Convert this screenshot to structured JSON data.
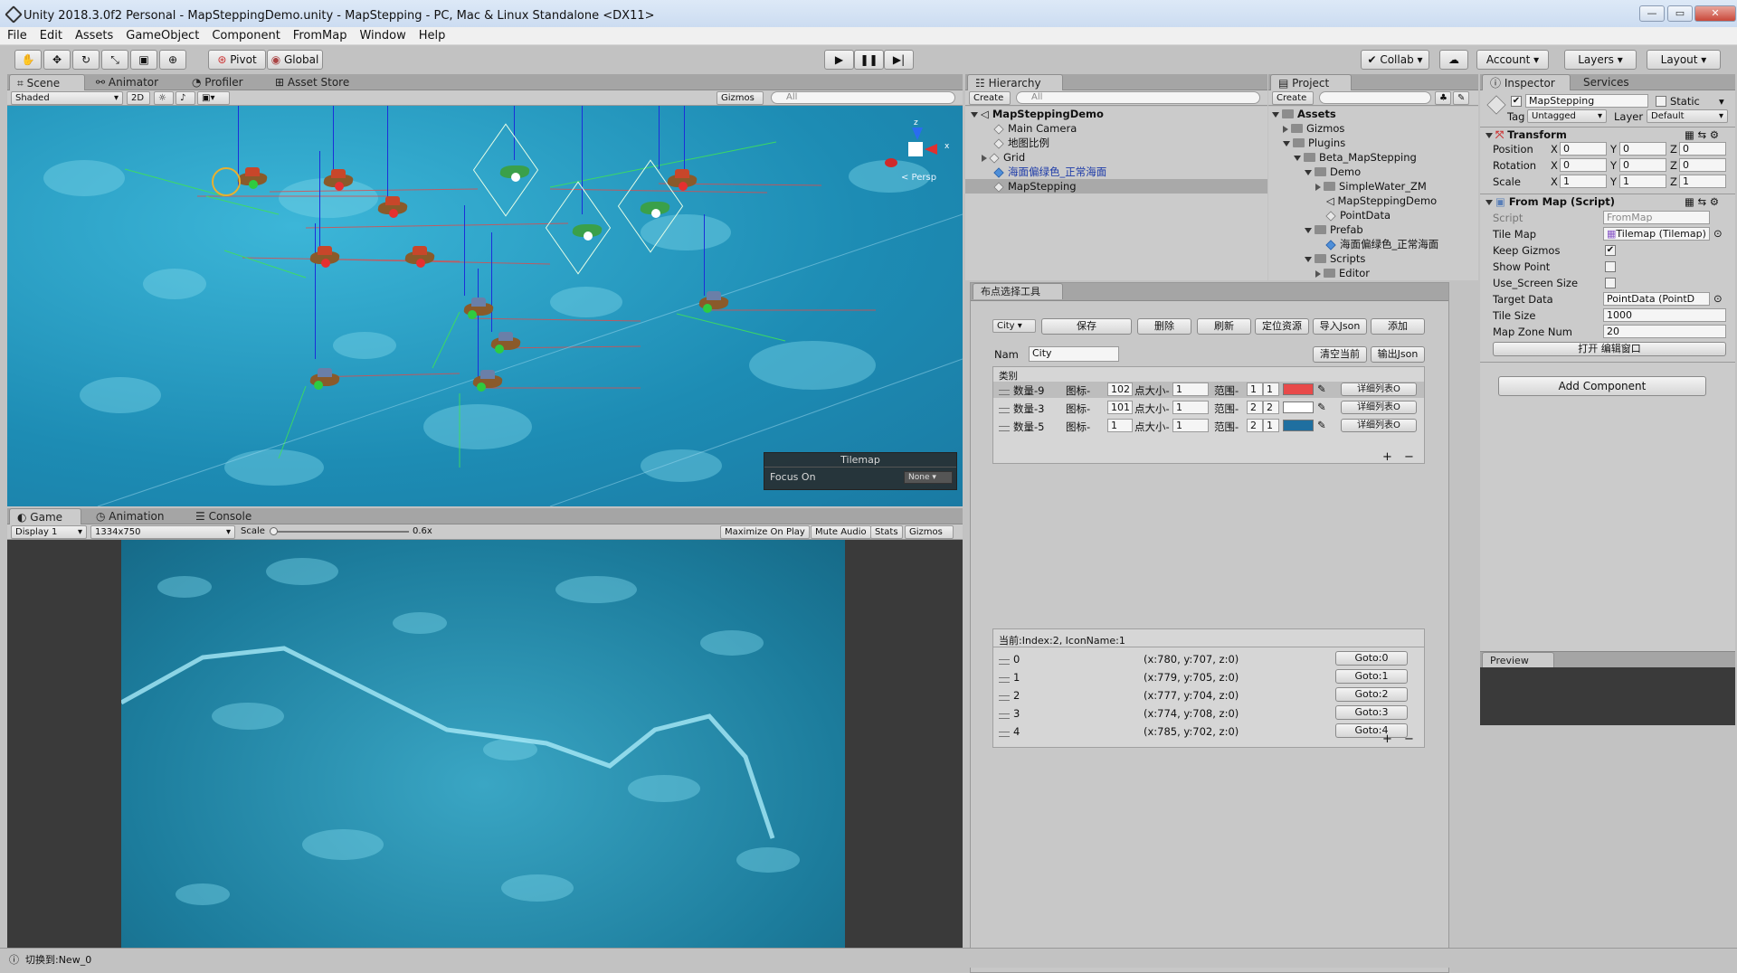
{
  "window": {
    "title": "Unity 2018.3.0f2 Personal - MapSteppingDemo.unity - MapStepping - PC, Mac & Linux Standalone <DX11>"
  },
  "menu": [
    "File",
    "Edit",
    "Assets",
    "GameObject",
    "Component",
    "FromMap",
    "Window",
    "Help"
  ],
  "toolbar": {
    "pivot": "Pivot",
    "global": "Global",
    "collab": "Collab",
    "account": "Account",
    "layers": "Layers",
    "layout": "Layout"
  },
  "scene_tabs": [
    "Scene",
    "Animator",
    "Profiler",
    "Asset Store"
  ],
  "scene_bar": {
    "shaded": "Shaded",
    "mode2d": "2D",
    "gizmos": "Gizmos",
    "search": "All"
  },
  "gizmo": {
    "persp": "< Persp",
    "axis_x": "x",
    "axis_z": "z"
  },
  "tilemap_overlay": {
    "title": "Tilemap",
    "focus_label": "Focus On",
    "focus_value": "None"
  },
  "game_tabs": [
    "Game",
    "Animation",
    "Console"
  ],
  "game_bar": {
    "display": "Display 1",
    "resolution": "1334x750",
    "scale_label": "Scale",
    "scale_value": "0.6x",
    "maximize": "Maximize On Play",
    "mute": "Mute Audio",
    "stats": "Stats",
    "gizmos": "Gizmos"
  },
  "hierarchy": {
    "tab": "Hierarchy",
    "create": "Create",
    "search": "All",
    "root": "MapSteppingDemo",
    "items": [
      "Main Camera",
      "地图比例",
      "Grid",
      "海面偏绿色_正常海面",
      "MapStepping"
    ]
  },
  "project": {
    "tab": "Project",
    "create": "Create",
    "items": [
      "Assets",
      "Gizmos",
      "Plugins",
      "Beta_MapStepping",
      "Demo",
      "SimpleWater_ZM",
      "MapSteppingDemo",
      "PointData",
      "Prefab",
      "海面偏绿色_正常海面",
      "Scripts",
      "Editor"
    ]
  },
  "tool_window": {
    "title": "布点选择工具",
    "type_select": "City",
    "buttons": {
      "save": "保存",
      "delete": "删除",
      "refresh": "刷新",
      "locate": "定位资源",
      "import": "导入Json",
      "add": "添加",
      "clear": "清空当前",
      "export": "输出Json"
    },
    "name_label": "Nam",
    "name_value": "City",
    "category_label": "类别",
    "rows": [
      {
        "count": "数量-9",
        "icon_label": "图标-",
        "icon_value": "102",
        "size_label": "点大小-",
        "size_value": "1",
        "range_label": "范围-",
        "r1": "1",
        "r2": "1",
        "color": "#e84a4a",
        "detail": "详细列表O"
      },
      {
        "count": "数量-3",
        "icon_label": "图标-",
        "icon_value": "101",
        "size_label": "点大小-",
        "size_value": "1",
        "range_label": "范围-",
        "r1": "2",
        "r2": "2",
        "color": "#ffffff",
        "detail": "详细列表O"
      },
      {
        "count": "数量-5",
        "icon_label": "图标-",
        "icon_value": "1",
        "size_label": "点大小-",
        "size_value": "1",
        "range_label": "范围-",
        "r1": "2",
        "r2": "1",
        "color": "#1f6fa0",
        "detail": "详细列表O"
      }
    ],
    "current": "当前:Index:2, IconName:1",
    "points": [
      {
        "idx": "0",
        "coord": "(x:780, y:707, z:0)",
        "goto": "Goto:0"
      },
      {
        "idx": "1",
        "coord": "(x:779, y:705, z:0)",
        "goto": "Goto:1"
      },
      {
        "idx": "2",
        "coord": "(x:777, y:704, z:0)",
        "goto": "Goto:2"
      },
      {
        "idx": "3",
        "coord": "(x:774, y:708, z:0)",
        "goto": "Goto:3"
      },
      {
        "idx": "4",
        "coord": "(x:785, y:702, z:0)",
        "goto": "Goto:4"
      }
    ],
    "plus": "+",
    "minus": "−"
  },
  "inspector": {
    "tab": "Inspector",
    "tab2": "Services",
    "object_name": "MapStepping",
    "static": "Static",
    "tag_label": "Tag",
    "tag_value": "Untagged",
    "layer_label": "Layer",
    "layer_value": "Default",
    "transform": {
      "title": "Transform",
      "position_label": "Position",
      "px": "0",
      "py": "0",
      "pz": "0",
      "rotation_label": "Rotation",
      "rx": "0",
      "ry": "0",
      "rz": "0",
      "scale_label": "Scale",
      "sx": "1",
      "sy": "1",
      "sz": "1"
    },
    "frommap": {
      "title": "From Map (Script)",
      "script_label": "Script",
      "script_value": "FromMap",
      "tilemap_label": "Tile Map",
      "tilemap_value": "Tilemap (Tilemap)",
      "keep_gizmos": "Keep Gizmos",
      "show_point": "Show Point",
      "use_screen_size": "Use_Screen Size",
      "target_data_label": "Target Data",
      "target_data_value": "PointData (PointD",
      "tile_size_label": "Tile Size",
      "tile_size_value": "1000",
      "map_zone_label": "Map Zone Num",
      "map_zone_value": "20",
      "open_editor": "打开 编辑窗口"
    },
    "add_component": "Add Component",
    "preview": "Preview"
  },
  "status": "切换到:New_0"
}
